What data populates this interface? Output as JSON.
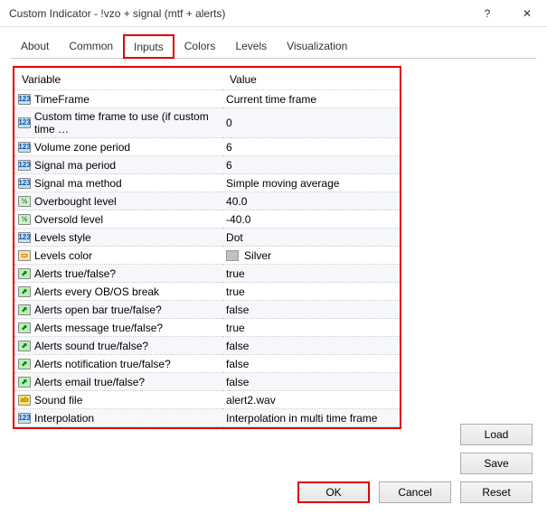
{
  "window": {
    "title": "Custom Indicator - !vzo + signal (mtf + alerts)",
    "help": "?",
    "close": "✕"
  },
  "tabs": {
    "items": [
      "About",
      "Common",
      "Inputs",
      "Colors",
      "Levels",
      "Visualization"
    ],
    "activeIndex": 2,
    "highlightIndex": 2
  },
  "grid": {
    "headers": {
      "variable": "Variable",
      "value": "Value"
    },
    "rows": [
      {
        "icon": "123",
        "variable": "TimeFrame",
        "value": "Current time frame"
      },
      {
        "icon": "123",
        "variable": "Custom time frame to use (if custom time …",
        "value": "0"
      },
      {
        "icon": "123",
        "variable": "Volume zone period",
        "value": "6"
      },
      {
        "icon": "123",
        "variable": "Signal ma period",
        "value": "6"
      },
      {
        "icon": "123",
        "variable": "Signal ma method",
        "value": "Simple moving average"
      },
      {
        "icon": "half",
        "variable": "Overbought level",
        "value": "40.0"
      },
      {
        "icon": "half",
        "variable": "Oversold level",
        "value": "-40.0"
      },
      {
        "icon": "123",
        "variable": "Levels style",
        "value": "Dot"
      },
      {
        "icon": "color",
        "variable": "Levels color",
        "value": "Silver",
        "swatch": "#c0c0c0"
      },
      {
        "icon": "chart",
        "variable": "Alerts true/false?",
        "value": "true"
      },
      {
        "icon": "chart",
        "variable": "Alerts every OB/OS break",
        "value": "true"
      },
      {
        "icon": "chart",
        "variable": "Alerts open bar true/false?",
        "value": "false"
      },
      {
        "icon": "chart",
        "variable": "Alerts message true/false?",
        "value": "true"
      },
      {
        "icon": "chart",
        "variable": "Alerts sound true/false?",
        "value": "false"
      },
      {
        "icon": "chart",
        "variable": "Alerts notification true/false?",
        "value": "false"
      },
      {
        "icon": "chart",
        "variable": "Alerts email true/false?",
        "value": "false"
      },
      {
        "icon": "ab",
        "variable": "Sound file",
        "value": "alert2.wav"
      },
      {
        "icon": "123",
        "variable": "Interpolation",
        "value": "Interpolation in multi time frame"
      }
    ]
  },
  "buttons": {
    "load": "Load",
    "save": "Save",
    "ok": "OK",
    "cancel": "Cancel",
    "reset": "Reset"
  },
  "icon_glyphs": {
    "123": "123",
    "half": "½",
    "chart": "⬈",
    "color": "▭",
    "ab": "ab"
  }
}
